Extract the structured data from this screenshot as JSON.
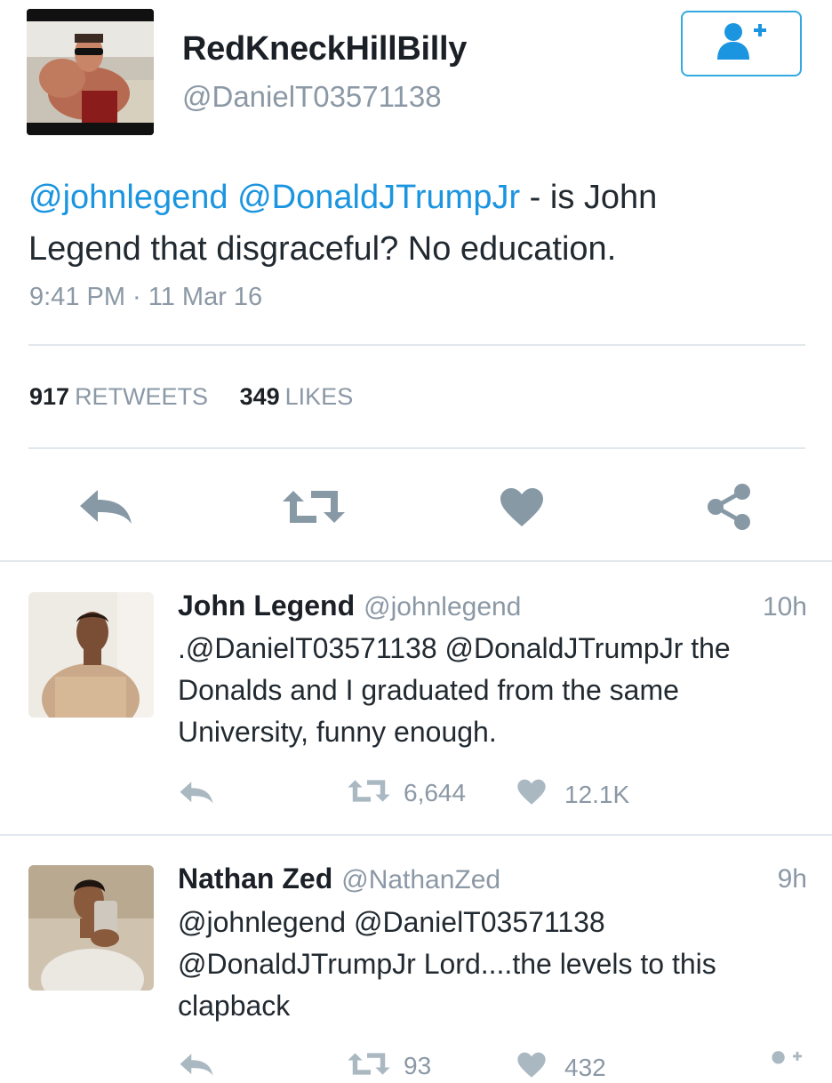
{
  "tweet": {
    "display_name": "RedKneckHillBilly",
    "screen_name": "@DanielT03571138",
    "text_mention_1": "@johnlegend",
    "text_mention_2": "@DonaldJTrumpJr",
    "text_body_1": " - is John",
    "text_body_2": "Legend that disgraceful?  No education.",
    "timestamp": "9:41 PM · 11 Mar 16",
    "retweet_count": "917",
    "retweet_label": "RETWEETS",
    "like_count": "349",
    "like_label": "LIKES",
    "follow_icon": "add-user-icon"
  },
  "actions": [
    "reply-icon",
    "retweet-icon",
    "heart-icon",
    "share-icon"
  ],
  "replies": [
    {
      "name": "John Legend",
      "handle": "@johnlegend",
      "time": "10h",
      "line_1": ".@DanielT03571138 @DonaldJTrumpJr the",
      "line_2": "Donalds and I graduated from the same",
      "line_3": "University, funny enough.",
      "retweets": "6,644",
      "likes": "12.1K"
    },
    {
      "name": "Nathan Zed",
      "handle": "@NathanZed",
      "time": "9h",
      "line_1": "@johnlegend @DanielT03571138",
      "line_2": "@DonaldJTrumpJr Lord....the levels to this",
      "line_3": "clapback",
      "retweets": "93",
      "likes": "432"
    }
  ],
  "colors": {
    "accent": "#1b95e0",
    "follow_border": "#32a9e0",
    "muted": "#8b98a5",
    "icon": "#8899a6",
    "divider": "#e1e8ed"
  }
}
